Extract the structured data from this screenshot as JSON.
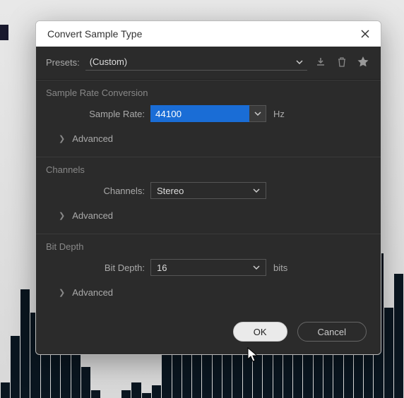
{
  "dialog": {
    "title": "Convert Sample Type",
    "presets": {
      "label": "Presets:",
      "value": "(Custom)"
    },
    "sections": {
      "sampleRate": {
        "title": "Sample Rate Conversion",
        "fieldLabel": "Sample Rate:",
        "value": "44100",
        "unit": "Hz",
        "advanced": "Advanced"
      },
      "channels": {
        "title": "Channels",
        "fieldLabel": "Channels:",
        "value": "Stereo",
        "advanced": "Advanced"
      },
      "bitDepth": {
        "title": "Bit Depth",
        "fieldLabel": "Bit Depth:",
        "value": "16",
        "unit": "bits",
        "advanced": "Advanced"
      }
    },
    "buttons": {
      "ok": "OK",
      "cancel": "Cancel"
    }
  }
}
